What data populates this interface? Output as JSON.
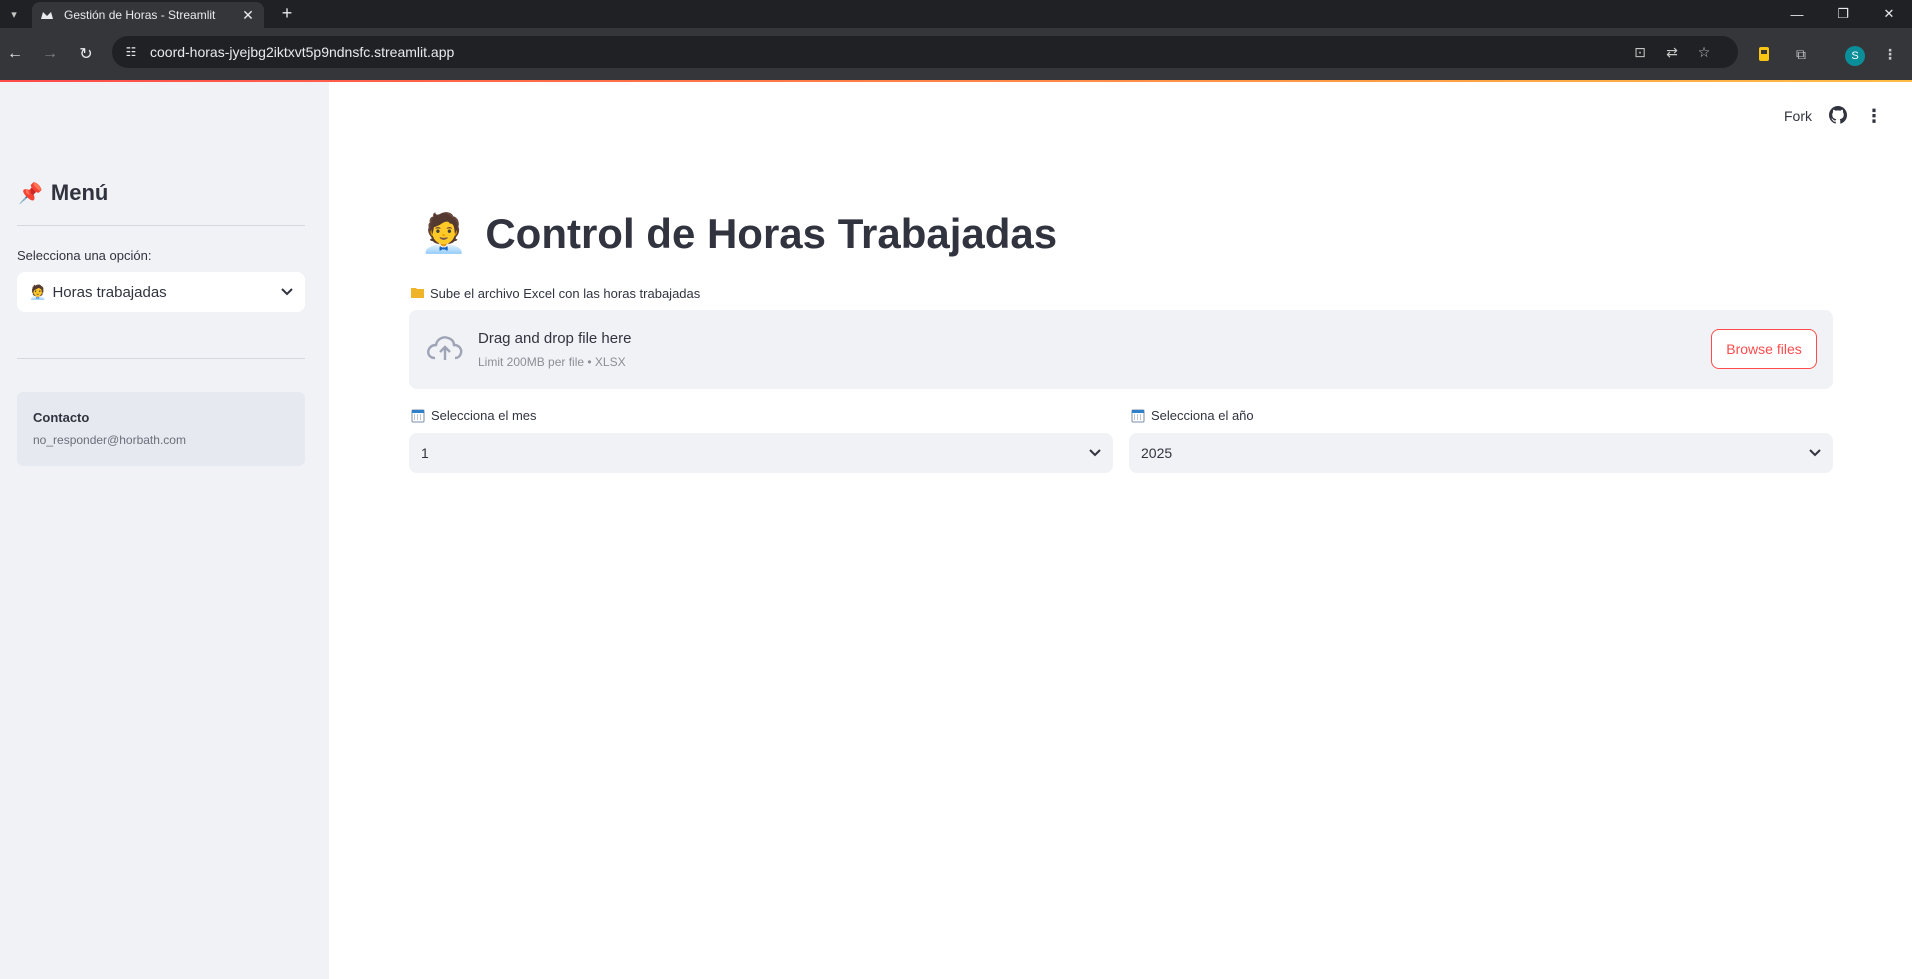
{
  "browser": {
    "tab_title": "Gestión de Horas - Streamlit",
    "url": "coord-horas-jyejbg2iktxvt5p9ndnsfc.streamlit.app",
    "profile_initial": "S"
  },
  "header": {
    "fork_label": "Fork"
  },
  "sidebar": {
    "menu_title": "Menú",
    "select_label": "Selecciona una opción:",
    "selected_option": "Horas trabajadas",
    "contact_title": "Contacto",
    "contact_email": "no_responder@horbath.com"
  },
  "main": {
    "title": "Control de Horas Trabajadas",
    "upload_label": "Sube el archivo Excel con las horas trabajadas",
    "dropzone_main": "Drag and drop file here",
    "dropzone_sub": "Limit 200MB per file • XLSX",
    "browse_label": "Browse files",
    "month_label": "Selecciona el mes",
    "month_value": "1",
    "year_label": "Selecciona el año",
    "year_value": "2025"
  },
  "colors": {
    "accent": "#ff4b4b",
    "sidebar_bg": "#f0f2f6",
    "text": "#31333f"
  }
}
